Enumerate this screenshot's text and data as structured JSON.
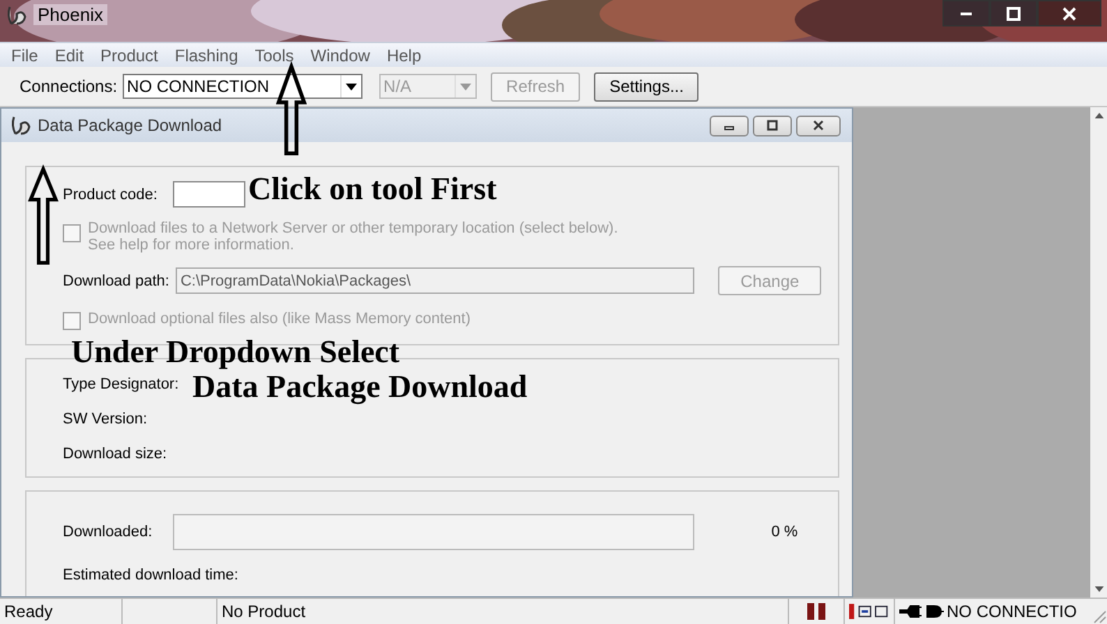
{
  "window": {
    "title": "Phoenix"
  },
  "menu": [
    "File",
    "Edit",
    "Product",
    "Flashing",
    "Tools",
    "Window",
    "Help"
  ],
  "toolbar": {
    "connections_label": "Connections:",
    "connection": "NO CONNECTION",
    "secondary": "N/A",
    "buttons": [
      {
        "label": "Refresh",
        "disabled": true
      },
      {
        "label": "Settings...",
        "disabled": false
      }
    ]
  },
  "dialog": {
    "title": "Data Package Download",
    "product_code_label": "Product code:",
    "network_option": {
      "lines": [
        "Download files to a Network Server or other temporary location (select below).",
        "See help for more information."
      ],
      "checked": false,
      "disabled": true
    },
    "download_path_label": "Download path:",
    "download_path": "C:\\ProgramData\\Nokia\\Packages\\",
    "change_button": {
      "label": "Change",
      "disabled": true
    },
    "optional_files": {
      "label": "Download optional files also (like Mass Memory content)",
      "checked": false,
      "disabled": true
    },
    "info": [
      "Type Designator:",
      "SW Version:",
      "Download size:"
    ],
    "progress": {
      "label": "Downloaded:",
      "level": 0,
      "reading": "0 %"
    },
    "estimated_label": "Estimated download time:"
  },
  "status_bar": {
    "state": "Ready",
    "product": "No Product",
    "connection": "NO CONNECTIO"
  },
  "annotations": [
    "Click on tool First",
    "Under Dropdown Select",
    "Data Package Download"
  ]
}
